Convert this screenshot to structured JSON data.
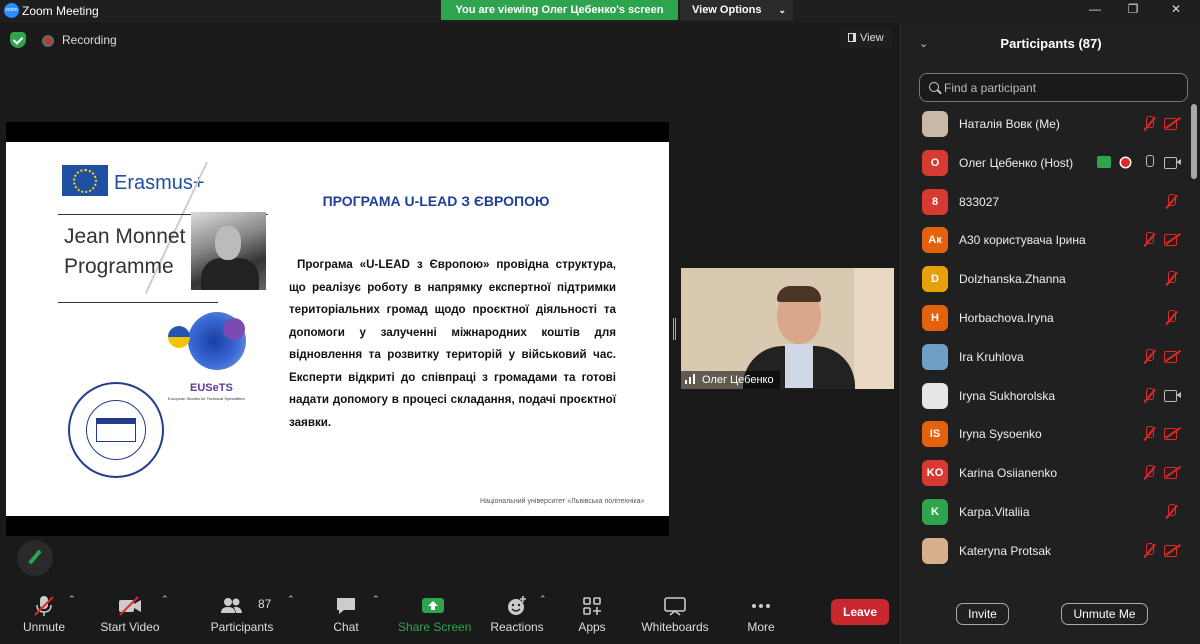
{
  "window": {
    "title": "Zoom Meeting",
    "app_icon": "zoom-logo"
  },
  "banner": {
    "text": "You are viewing Олег Цебенко's screen",
    "color": "#2ea44f"
  },
  "view_options": {
    "label": "View Options"
  },
  "status": {
    "recording_label": "Recording",
    "view_label": "View"
  },
  "slide": {
    "title": "ПРОГРАМА U-LEAD З ЄВРОПОЮ",
    "body": "Програма «U-LEAD з Європою» провідна структура, що реалізує роботу в напрямку експертної підтримки територіальних громад щодо проєктної діяльності та допомоги у залученні міжнародних коштів для відновлення та розвитку територій у військовий час. Експерти відкриті до співпраці з громадами та готові надати допомогу в процесі складання, подачі проєктної заявки.",
    "erasmus": "Erasmus+",
    "jean_monnet": "Jean Monnet Programme",
    "euset_name": "EUSeTS",
    "euset_sub": "European Studies for Technical Specialities",
    "footer": "Національний університет «Львівська політехніка»"
  },
  "video": {
    "name": "Олег Цебенко"
  },
  "toolbar": {
    "unmute": "Unmute",
    "start_video": "Start Video",
    "participants": "Participants",
    "participants_count": "87",
    "chat": "Chat",
    "share_screen": "Share Screen",
    "reactions": "Reactions",
    "apps": "Apps",
    "whiteboards": "Whiteboards",
    "more": "More",
    "leave": "Leave"
  },
  "panel": {
    "title": "Participants (87)",
    "search_placeholder": "Find a participant",
    "invite": "Invite",
    "unmute_me": "Unmute Me",
    "participants": [
      {
        "name": "Наталія Вовк (Me)",
        "initials": "",
        "avatar_color": "#c9b7a8",
        "mic": "muted",
        "cam": "off"
      },
      {
        "name": "Олег Цебенко (Host)",
        "initials": "О",
        "avatar_color": "#d63a31",
        "mic": "on",
        "cam": "on",
        "sharing": true,
        "recording": true
      },
      {
        "name": "833027",
        "initials": "8",
        "avatar_color": "#d63a31",
        "mic": "muted",
        "cam": "none"
      },
      {
        "name": "А30 користувача Ірина",
        "initials": "Ак",
        "avatar_color": "#e4620c",
        "mic": "muted",
        "cam": "off"
      },
      {
        "name": "Dolzhanska.Zhanna",
        "initials": "D",
        "avatar_color": "#e8a00c",
        "mic": "muted",
        "cam": "none"
      },
      {
        "name": "Horbachova.Iryna",
        "initials": "H",
        "avatar_color": "#e4620c",
        "mic": "muted",
        "cam": "none"
      },
      {
        "name": "Ira Kruhlova",
        "initials": "",
        "avatar_color": "#6f9fc4",
        "mic": "muted",
        "cam": "off"
      },
      {
        "name": "Iryna Sukhorolska",
        "initials": "",
        "avatar_color": "#e6e6e6",
        "mic": "muted",
        "cam": "on"
      },
      {
        "name": "Iryna Sysoenko",
        "initials": "IS",
        "avatar_color": "#e4620c",
        "mic": "muted",
        "cam": "off"
      },
      {
        "name": "Karina Osiianenko",
        "initials": "KO",
        "avatar_color": "#d63a31",
        "mic": "muted",
        "cam": "off"
      },
      {
        "name": "Karpa.Vitaliia",
        "initials": "K",
        "avatar_color": "#2ea44f",
        "mic": "muted",
        "cam": "none"
      },
      {
        "name": "Kateryna Protsak",
        "initials": "",
        "avatar_color": "#d9b08c",
        "mic": "muted",
        "cam": "off"
      }
    ]
  }
}
